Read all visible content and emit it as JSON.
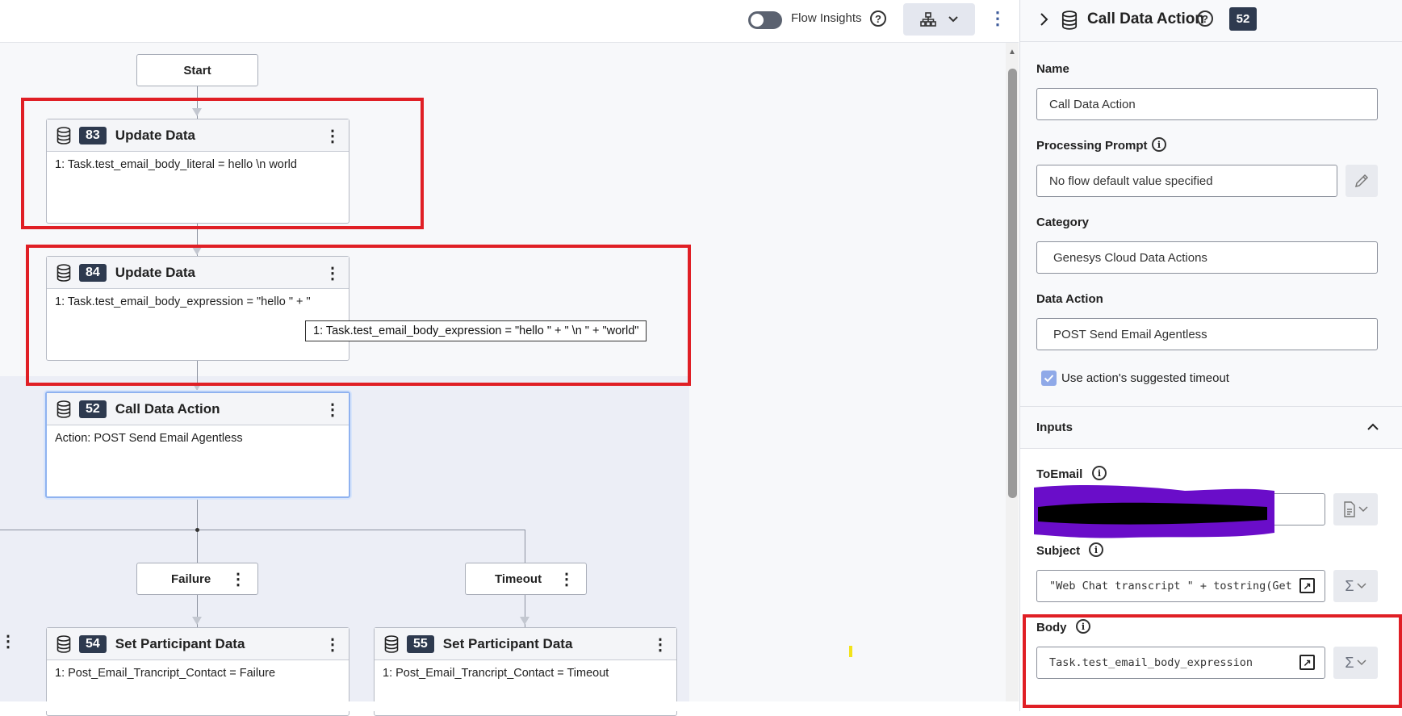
{
  "topbar": {
    "flow_insights_label": "Flow Insights",
    "help_glyph": "?",
    "layout_icon": "sitemap-icon",
    "more_icon": "kebab-icon"
  },
  "flow": {
    "start_label": "Start",
    "nodes": [
      {
        "number": "83",
        "title": "Update Data",
        "body": "1: Task.test_email_body_literal = hello \\n world"
      },
      {
        "number": "84",
        "title": "Update Data",
        "body": "1: Task.test_email_body_expression = \"hello \" + \""
      },
      {
        "number": "52",
        "title": "Call Data Action",
        "body": "Action: POST Send Email Agentless"
      },
      {
        "number": "54",
        "title": "Set Participant Data",
        "body": "1: Post_Email_Trancript_Contact = Failure"
      },
      {
        "number": "55",
        "title": "Set Participant Data",
        "body": "1: Post_Email_Trancript_Contact = Timeout"
      }
    ],
    "tooltip": "1: Task.test_email_body_expression = \"hello \" + \" \\n \" + \"world\"",
    "branches": {
      "failure": "Failure",
      "timeout": "Timeout"
    }
  },
  "panel": {
    "title": "Call Data Action",
    "number": "52",
    "name_label": "Name",
    "name_value": "Call Data Action",
    "processing_prompt_label": "Processing Prompt",
    "processing_prompt_value": "No flow default value specified",
    "category_label": "Category",
    "category_value": "Genesys Cloud Data Actions",
    "data_action_label": "Data Action",
    "data_action_value": "POST Send Email Agentless",
    "timeout_checkbox_label": "Use action's suggested timeout",
    "timeout_checked": true,
    "inputs_label": "Inputs",
    "to_email_label": "ToEmail",
    "subject_label": "Subject",
    "subject_value": "\"Web Chat transcript \" + tostring(Get",
    "body_label": "Body",
    "body_value": "Task.test_email_body_expression",
    "info_glyph": "i",
    "sum_glyph": "Σ"
  },
  "colors": {
    "highlight_red": "#e01f25",
    "redaction_purple": "#6a0dc9",
    "badge_dark": "#2e3a4f",
    "selected_border": "#8fb2f0"
  }
}
